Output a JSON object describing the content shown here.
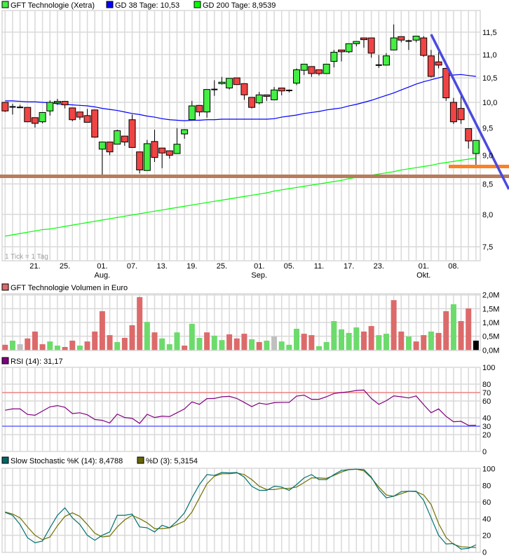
{
  "legend": {
    "main": "GFT Technologie (Xetra)",
    "gd38": "GD 38 Tage: 10,53",
    "gd200": "GD 200 Tage: 8,9539",
    "volume": "GFT Technologie Volumen in Euro",
    "rsi": "RSI (14): 31,17",
    "stoch_k": "Slow Stochastic %K (14): 8,4788",
    "stoch_d": "%D (3): 5,3154"
  },
  "tick_note": "1 Tick = 1 Tag",
  "colors": {
    "up": "#44ee44",
    "down": "#f04444",
    "doji": "#000000",
    "vol_up": "#6cdb6c",
    "vol_down": "#dd6a6a",
    "vol_flat": "#c0c0c0",
    "gd38": "#0000ff",
    "gd200": "#00ff00",
    "rsi": "#800080",
    "rsi_70": "#f08080",
    "rsi_30": "#6666ff",
    "stoch_k": "#007070",
    "stoch_d": "#707000",
    "support": "#b87c5c",
    "orange_level": "#ff8020",
    "trendline": "#4a4adf",
    "grid": "#d9d9d9"
  },
  "chart_data": [
    {
      "type": "candlestick",
      "scale": "log",
      "ylim": [
        7.3,
        11.8
      ],
      "y_ticks": [
        {
          "v": 11.5,
          "label": "11,5"
        },
        {
          "v": 11.0,
          "label": "11,0"
        },
        {
          "v": 10.5,
          "label": "10,5"
        },
        {
          "v": 10.0,
          "label": "10,0"
        },
        {
          "v": 9.5,
          "label": "9,5"
        },
        {
          "v": 9.0,
          "label": "9,0"
        },
        {
          "v": 8.5,
          "label": "8,5"
        },
        {
          "v": 8.0,
          "label": "8,0"
        },
        {
          "v": 7.5,
          "label": "7,5"
        }
      ],
      "x_labels": [
        {
          "i": 4,
          "label": "21."
        },
        {
          "i": 8,
          "label": "25."
        },
        {
          "i": 13,
          "label": "01."
        },
        {
          "i": 17,
          "label": "07."
        },
        {
          "i": 21,
          "label": "13."
        },
        {
          "i": 25,
          "label": "19."
        },
        {
          "i": 29,
          "label": "25."
        },
        {
          "i": 34,
          "label": "01."
        },
        {
          "i": 38,
          "label": "05."
        },
        {
          "i": 42,
          "label": "11."
        },
        {
          "i": 46,
          "label": "17."
        },
        {
          "i": 50,
          "label": "23."
        },
        {
          "i": 56,
          "label": "01."
        },
        {
          "i": 60,
          "label": "08."
        }
      ],
      "month_labels": [
        {
          "i": 13,
          "label": "Aug."
        },
        {
          "i": 34,
          "label": "Sep."
        },
        {
          "i": 56,
          "label": "Okt."
        }
      ],
      "ohlc": [
        [
          10.0,
          10.0,
          9.81,
          9.83
        ],
        [
          9.91,
          9.97,
          9.76,
          9.91
        ],
        [
          9.9,
          9.95,
          9.9,
          9.9
        ],
        [
          9.9,
          9.9,
          9.62,
          9.62
        ],
        [
          9.7,
          9.7,
          9.51,
          9.59
        ],
        [
          9.62,
          9.8,
          9.59,
          9.8
        ],
        [
          9.83,
          10.04,
          9.74,
          10.0
        ],
        [
          9.99,
          10.07,
          9.95,
          10.02
        ],
        [
          10.02,
          10.02,
          9.88,
          9.95
        ],
        [
          9.89,
          9.89,
          9.63,
          9.66
        ],
        [
          9.81,
          9.81,
          9.66,
          9.71
        ],
        [
          9.74,
          9.87,
          9.61,
          9.61
        ],
        [
          9.85,
          9.85,
          9.32,
          9.33
        ],
        [
          9.11,
          9.24,
          8.62,
          9.24
        ],
        [
          9.24,
          9.24,
          9.0,
          9.06
        ],
        [
          9.2,
          9.47,
          9.2,
          9.45
        ],
        [
          9.35,
          9.35,
          9.17,
          9.24
        ],
        [
          9.66,
          9.76,
          9.14,
          9.14
        ],
        [
          9.06,
          9.06,
          8.68,
          8.74
        ],
        [
          8.73,
          9.28,
          8.73,
          9.21
        ],
        [
          9.25,
          9.47,
          8.88,
          8.96
        ],
        [
          9.13,
          9.13,
          8.77,
          9.04
        ],
        [
          9.08,
          9.08,
          8.94,
          9.0
        ],
        [
          9.03,
          9.5,
          9.03,
          9.2
        ],
        [
          9.39,
          9.48,
          9.3,
          9.47
        ],
        [
          9.66,
          10.03,
          9.66,
          9.93
        ],
        [
          9.94,
          9.94,
          9.73,
          9.81
        ],
        [
          9.81,
          10.26,
          9.7,
          10.26
        ],
        [
          10.26,
          10.45,
          10.13,
          10.26
        ],
        [
          10.38,
          10.52,
          10.36,
          10.41
        ],
        [
          10.29,
          10.49,
          10.26,
          10.49
        ],
        [
          10.5,
          10.5,
          10.36,
          10.36
        ],
        [
          10.38,
          10.38,
          10.05,
          10.15
        ],
        [
          10.1,
          10.1,
          9.88,
          9.9
        ],
        [
          9.99,
          10.21,
          9.96,
          10.15
        ],
        [
          10.15,
          10.15,
          10.03,
          10.12
        ],
        [
          10.05,
          10.31,
          10.05,
          10.25
        ],
        [
          10.29,
          10.29,
          10.14,
          10.23
        ],
        [
          10.24,
          10.26,
          10.2,
          10.24
        ],
        [
          10.39,
          10.7,
          10.35,
          10.67
        ],
        [
          10.66,
          10.79,
          10.56,
          10.79
        ],
        [
          10.74,
          10.74,
          10.52,
          10.59
        ],
        [
          10.67,
          10.67,
          10.55,
          10.59
        ],
        [
          10.59,
          10.79,
          10.59,
          10.79
        ],
        [
          10.85,
          11.1,
          10.72,
          11.05
        ],
        [
          11.1,
          11.1,
          10.85,
          11.06
        ],
        [
          11.06,
          11.24,
          11.03,
          11.24
        ],
        [
          11.24,
          11.29,
          11.18,
          11.29
        ],
        [
          11.37,
          11.37,
          11.15,
          11.33
        ],
        [
          11.37,
          11.37,
          10.93,
          11.03
        ],
        [
          10.77,
          10.99,
          10.71,
          10.77
        ],
        [
          10.77,
          11.03,
          10.77,
          10.97
        ],
        [
          11.1,
          11.68,
          11.1,
          11.37
        ],
        [
          11.4,
          11.4,
          11.27,
          11.32
        ],
        [
          11.3,
          11.33,
          11.1,
          11.3
        ],
        [
          11.32,
          11.41,
          11.27,
          11.41
        ],
        [
          11.37,
          11.41,
          10.95,
          10.98
        ],
        [
          10.97,
          11.1,
          10.51,
          10.53
        ],
        [
          10.84,
          11.05,
          10.7,
          10.77
        ],
        [
          10.7,
          10.7,
          10.03,
          10.09
        ],
        [
          10.0,
          10.09,
          9.58,
          9.62
        ],
        [
          9.88,
          10.15,
          9.58,
          9.66
        ],
        [
          9.49,
          9.49,
          9.12,
          9.26
        ],
        [
          9.03,
          9.27,
          8.8,
          9.27
        ]
      ],
      "gd38": [
        10.03,
        10.03,
        10.02,
        10.01,
        10.01,
        10.0,
        9.99,
        9.97,
        9.96,
        9.95,
        9.94,
        9.93,
        9.91,
        9.88,
        9.86,
        9.84,
        9.81,
        9.78,
        9.76,
        9.73,
        9.71,
        9.68,
        9.66,
        9.65,
        9.64,
        9.65,
        9.65,
        9.66,
        9.66,
        9.67,
        9.67,
        9.67,
        9.67,
        9.67,
        9.67,
        9.67,
        9.68,
        9.71,
        9.73,
        9.75,
        9.78,
        9.8,
        9.82,
        9.85,
        9.87,
        9.89,
        9.93,
        9.96,
        10.0,
        10.04,
        10.09,
        10.14,
        10.19,
        10.25,
        10.31,
        10.37,
        10.42,
        10.46,
        10.5,
        10.54,
        10.56,
        10.57,
        10.55,
        10.53
      ],
      "gd200": [
        7.66,
        7.68,
        7.7,
        7.72,
        7.74,
        7.76,
        7.77,
        7.79,
        7.81,
        7.83,
        7.85,
        7.87,
        7.89,
        7.91,
        7.93,
        7.95,
        7.97,
        7.99,
        8.01,
        8.03,
        8.05,
        8.07,
        8.09,
        8.11,
        8.13,
        8.15,
        8.17,
        8.19,
        8.21,
        8.23,
        8.25,
        8.27,
        8.29,
        8.31,
        8.33,
        8.35,
        8.38,
        8.4,
        8.42,
        8.44,
        8.46,
        8.48,
        8.5,
        8.52,
        8.54,
        8.56,
        8.59,
        8.61,
        8.63,
        8.65,
        8.67,
        8.69,
        8.71,
        8.74,
        8.76,
        8.78,
        8.8,
        8.82,
        8.85,
        8.87,
        8.89,
        8.91,
        8.93,
        8.95
      ],
      "annotations": {
        "support_level": 8.63,
        "orange_level": 8.8,
        "trendline": {
          "from": {
            "i": 57,
            "price": 11.45
          },
          "to": {
            "i": 67.4,
            "price": 8.41
          }
        }
      }
    },
    {
      "type": "bar",
      "unit": "M",
      "ylim": [
        0,
        2.0
      ],
      "y_ticks": [
        {
          "v": 2.0,
          "label": "2,0M"
        },
        {
          "v": 1.5,
          "label": "1,5M"
        },
        {
          "v": 1.0,
          "label": "1,0M"
        },
        {
          "v": 0.5,
          "label": "0,5M"
        },
        {
          "v": 0.0,
          "label": "0,0M"
        }
      ],
      "values": [
        0.19,
        0.34,
        0.21,
        0.42,
        0.67,
        0.21,
        0.31,
        0.16,
        0.11,
        0.34,
        0.16,
        0.31,
        0.67,
        1.41,
        0.54,
        0.29,
        0.44,
        0.9,
        1.92,
        1.02,
        0.64,
        0.42,
        0.21,
        0.64,
        0.16,
        0.95,
        0.44,
        0.64,
        0.52,
        0.36,
        0.57,
        0.42,
        0.59,
        0.39,
        0.29,
        0.34,
        0.49,
        0.31,
        0.19,
        0.77,
        0.59,
        0.54,
        0.14,
        0.29,
        1.05,
        0.75,
        0.62,
        0.82,
        0.67,
        0.87,
        0.54,
        0.59,
        1.81,
        0.67,
        0.49,
        0.31,
        0.54,
        0.67,
        0.62,
        1.41,
        1.66,
        1.05,
        1.51,
        0.34
      ],
      "direction": "dunddduuddudddduddduduuuduuduudddudunuuudduuuuuudduuddudduddudd"
    },
    {
      "type": "line",
      "ylim": [
        0,
        100
      ],
      "y_ticks": [
        {
          "v": 100,
          "label": "100"
        },
        {
          "v": 80,
          "label": "80"
        },
        {
          "v": 70,
          "label": "70",
          "tone": "rsi_70"
        },
        {
          "v": 60,
          "label": "60"
        },
        {
          "v": 40,
          "label": "40"
        },
        {
          "v": 30,
          "label": "30",
          "tone": "rsi_30"
        },
        {
          "v": 20,
          "label": "20"
        },
        {
          "v": 0,
          "label": "0"
        }
      ],
      "levels": [
        70,
        30
      ],
      "values": [
        49,
        50.6,
        50.6,
        44,
        43,
        48,
        53,
        54.5,
        52.5,
        45,
        46,
        43.6,
        38,
        37,
        33.8,
        44.4,
        40.3,
        39.4,
        33.3,
        44.2,
        40.3,
        42,
        41.4,
        46,
        50.6,
        58.9,
        56,
        62.8,
        63,
        65,
        65.5,
        63,
        58.3,
        53.3,
        57.5,
        56,
        58,
        58.3,
        58.3,
        65.8,
        67,
        62,
        62,
        65,
        68.9,
        70,
        71,
        72.5,
        73,
        63,
        56,
        60.3,
        66,
        65,
        63.6,
        66,
        55.6,
        46,
        50.6,
        41.7,
        35.3,
        35.8,
        31,
        31.17
      ]
    },
    {
      "type": "line",
      "ylim": [
        0,
        100
      ],
      "y_ticks": [
        {
          "v": 100,
          "label": "100"
        },
        {
          "v": 80,
          "label": "80"
        },
        {
          "v": 60,
          "label": "60"
        },
        {
          "v": 40,
          "label": "40"
        },
        {
          "v": 20,
          "label": "20"
        },
        {
          "v": 0,
          "label": "0"
        }
      ],
      "series": [
        {
          "name": "Slow Stochastic %K (14)",
          "values": [
            47.5,
            44,
            33,
            17,
            11,
            13,
            29,
            44,
            53,
            41,
            33,
            20,
            14,
            20,
            24,
            44,
            44,
            45.5,
            30,
            29,
            24,
            32,
            29,
            37,
            47,
            65,
            81,
            93,
            92,
            95.5,
            95,
            95.5,
            90,
            79,
            74,
            74,
            79,
            78,
            74,
            81,
            89,
            93,
            87,
            87,
            93,
            98,
            99,
            99.5,
            99,
            90,
            75,
            65,
            67,
            72.5,
            73,
            73,
            62,
            41,
            20,
            9.5,
            10,
            3.4,
            4.2,
            8.48
          ]
        },
        {
          "name": "%D (3)",
          "values": [
            48,
            45.5,
            41,
            30,
            20,
            14.6,
            18,
            31.5,
            42.7,
            47,
            42.7,
            33,
            22.5,
            18,
            19,
            30,
            38.5,
            44,
            40,
            35,
            28,
            28,
            29,
            33,
            37,
            48,
            65,
            82,
            91,
            94,
            94,
            95,
            93,
            87,
            79,
            75,
            75,
            76.4,
            76.4,
            78,
            83.4,
            89,
            89,
            88.5,
            92,
            96,
            99,
            99.5,
            97.5,
            89,
            78,
            68.5,
            67,
            70,
            73,
            72.5,
            68.5,
            57,
            34,
            17.4,
            9,
            6.2,
            5.6,
            5.3154
          ]
        }
      ]
    }
  ]
}
